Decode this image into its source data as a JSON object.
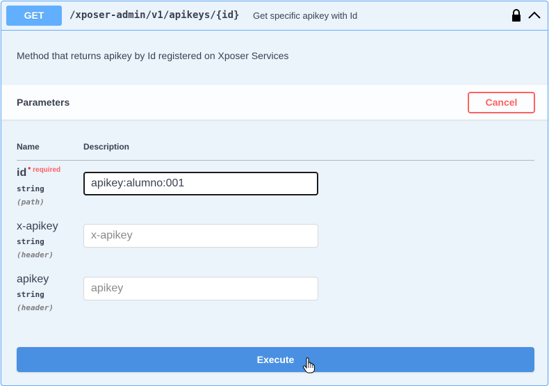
{
  "operation": {
    "method": "GET",
    "path": "/xposer-admin/v1/apikeys/{id}",
    "summary": "Get specific apikey with Id",
    "description": "Method that returns apikey by Id registered on Xposer Services",
    "method_color": "#61affe",
    "icons": [
      "lock-icon",
      "chevron-up-icon"
    ]
  },
  "parameters": {
    "title": "Parameters",
    "cancel_label": "Cancel",
    "columns": {
      "name": "Name",
      "description": "Description"
    },
    "items": [
      {
        "name": "id",
        "required_star": "*",
        "required_label": "required",
        "type": "string",
        "in": "(path)",
        "value": "apikey:alumno:001",
        "placeholder": ""
      },
      {
        "name": "x-apikey",
        "type": "string",
        "in": "(header)",
        "value": "",
        "placeholder": "x-apikey"
      },
      {
        "name": "apikey",
        "type": "string",
        "in": "(header)",
        "value": "",
        "placeholder": "apikey"
      }
    ]
  },
  "execute_label": "Execute",
  "colors": {
    "accent": "#61affe",
    "execute": "#4990e2",
    "cancel": "#ff6060",
    "background": "#ebf3fb"
  }
}
